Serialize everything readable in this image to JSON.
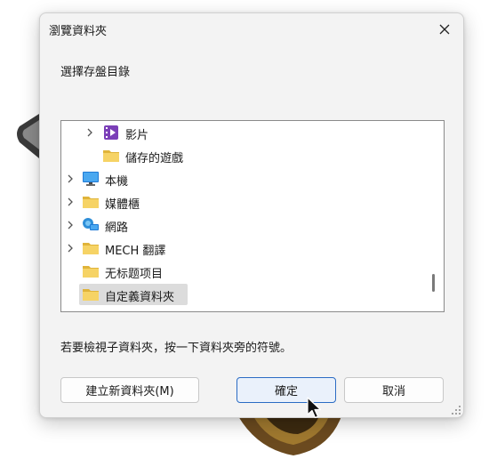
{
  "dialog": {
    "title": "瀏覽資料夾",
    "prompt": "選擇存盤目錄",
    "hint": "若要檢視子資料夾，按一下資料夾旁的符號。"
  },
  "tree": {
    "items": [
      {
        "label": "影片",
        "icon": "video-folder-icon",
        "expandable": true,
        "level": 1
      },
      {
        "label": "儲存的遊戲",
        "icon": "folder-icon",
        "expandable": false,
        "level": 1
      },
      {
        "label": "本機",
        "icon": "computer-icon",
        "expandable": true,
        "level": 0
      },
      {
        "label": "媒體櫃",
        "icon": "folder-icon",
        "expandable": true,
        "level": 0
      },
      {
        "label": "網路",
        "icon": "network-icon",
        "expandable": true,
        "level": 0
      },
      {
        "label": "MECH 翻譯",
        "icon": "folder-icon",
        "expandable": true,
        "level": 0
      },
      {
        "label": "无标题项目",
        "icon": "folder-icon",
        "expandable": false,
        "level": 0
      },
      {
        "label": "自定義資料夾",
        "icon": "folder-icon",
        "expandable": false,
        "level": 0,
        "selected": true
      }
    ]
  },
  "buttons": {
    "new_folder": "建立新資料夾(M)",
    "ok": "確定",
    "cancel": "取消"
  },
  "colors": {
    "folder": "#f2c94c",
    "accent": "#2b6cc4",
    "selection": "#dcdcdc"
  }
}
